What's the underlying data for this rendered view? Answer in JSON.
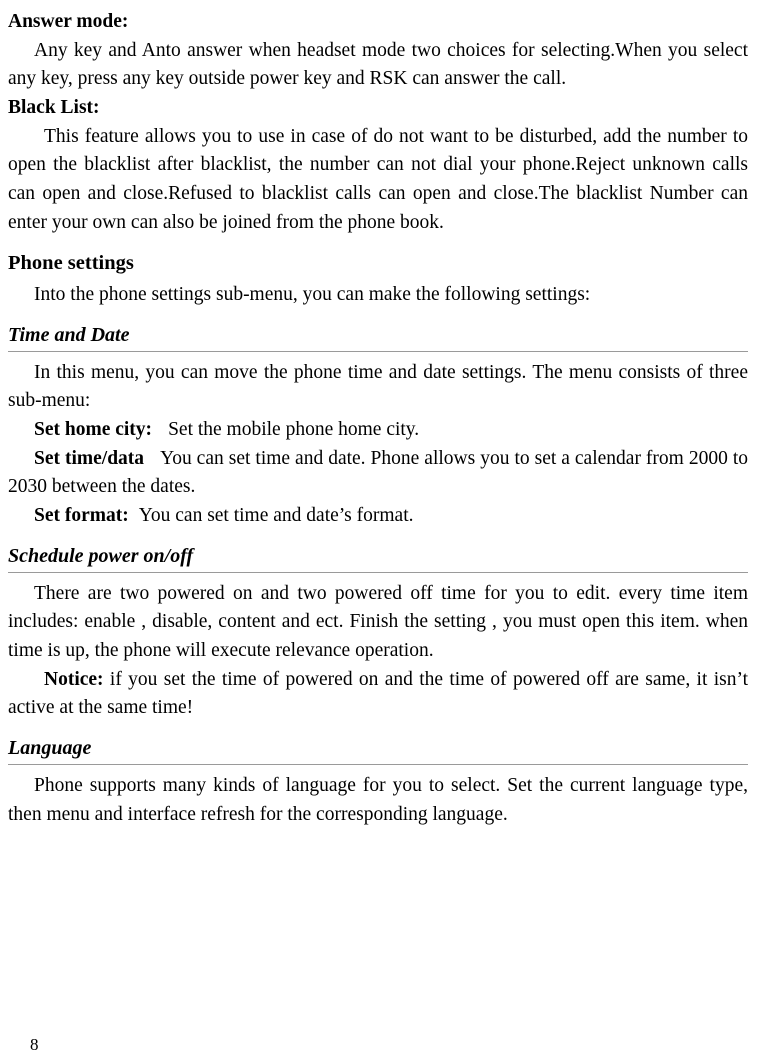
{
  "document": {
    "page_number": "8",
    "blocks": [
      {
        "id": "answer_mode_heading",
        "text": "Answer mode:"
      },
      {
        "id": "answer_mode_body",
        "text": "Any key and Anto answer when headset mode two choices for selecting.When you select any key, press any key outside power key and RSK can answer the call."
      },
      {
        "id": "black_list_heading",
        "text": "Black List:"
      },
      {
        "id": "black_list_body",
        "text": "This feature allows you to use in case of do not want to be disturbed, add the number to open the blacklist after blacklist, the number can not dial your phone.Reject unknown calls can open and close.Refused to blacklist calls can open and close.The blacklist Number can enter your own can also be joined from the phone book."
      },
      {
        "id": "phone_settings_heading",
        "text": "Phone settings"
      },
      {
        "id": "phone_settings_body",
        "text": "Into the phone settings sub-menu, you can make the following settings:"
      },
      {
        "id": "time_and_date_heading",
        "text": "Time and Date"
      },
      {
        "id": "time_and_date_body",
        "text": "In this menu, you can move the phone time and date settings. The menu consists of three sub-menu:"
      },
      {
        "id": "set_home_city_label",
        "text": "Set home city:"
      },
      {
        "id": "set_home_city_desc",
        "text": "Set the mobile phone home city."
      },
      {
        "id": "set_time_data_label",
        "text": "Set time/data"
      },
      {
        "id": "set_time_data_desc",
        "text": "You can set time and date. Phone allows you to set a calendar from 2000 to 2030 between the dates."
      },
      {
        "id": "set_format_label",
        "text": "Set format:"
      },
      {
        "id": "set_format_desc",
        "text": "You can set time and date’s format."
      },
      {
        "id": "schedule_power_heading",
        "text": "Schedule power on/off"
      },
      {
        "id": "schedule_power_body",
        "text": "There are two powered on and two powered off time for you to edit. every time item includes: enable , disable, content and ect. Finish the setting , you must open this item. when time is up, the phone will execute relevance operation."
      },
      {
        "id": "notice_label",
        "text": "Notice:"
      },
      {
        "id": "notice_body",
        "text": "if you set the time of powered on and the time of powered off are same, it isn’t active at the same time!"
      },
      {
        "id": "language_heading",
        "text": "Language"
      },
      {
        "id": "language_body",
        "text": "Phone supports many kinds of language for you to select. Set the current language type, then menu and interface refresh for the corresponding language."
      }
    ]
  }
}
